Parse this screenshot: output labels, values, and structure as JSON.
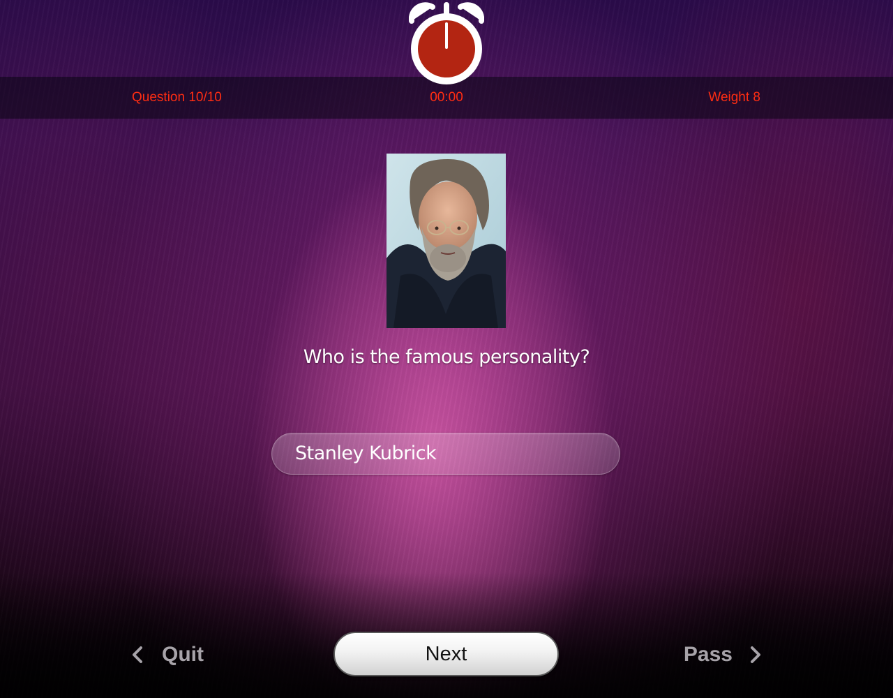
{
  "status": {
    "question": "Question 10/10",
    "timer": "00:00",
    "weight": "Weight 8"
  },
  "question": {
    "prompt": "Who is the famous personality?",
    "answer": "Stanley Kubrick"
  },
  "nav": {
    "quit_label": "Quit",
    "next_label": "Next",
    "pass_label": "Pass"
  },
  "icons": {
    "timer": "alarm-clock-icon",
    "quit": "chevron-left-icon",
    "pass": "chevron-right-icon"
  },
  "colors": {
    "status_text": "#ff2d12",
    "clock_face": "#b32512",
    "nav_text": "#a7a3a9"
  }
}
